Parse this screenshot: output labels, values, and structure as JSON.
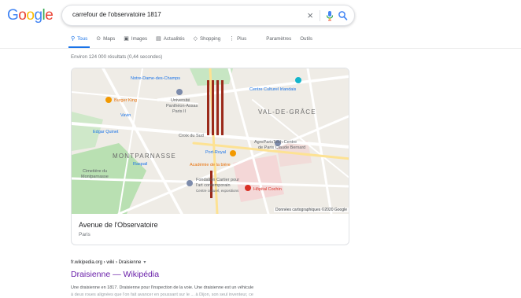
{
  "header": {
    "logo_letters": [
      "G",
      "o",
      "o",
      "g",
      "l",
      "e"
    ],
    "logo_colors": [
      "#4285f4",
      "#ea4335",
      "#fbbc05",
      "#4285f4",
      "#34a853",
      "#ea4335"
    ],
    "query": "carrefour de l'observatoire 1817",
    "clear_glyph": "×"
  },
  "tabs": [
    {
      "glyph": "⚲",
      "label": "Tous",
      "active": true
    },
    {
      "glyph": "⊙",
      "label": "Maps"
    },
    {
      "glyph": "▣",
      "label": "Images"
    },
    {
      "glyph": "▤",
      "label": "Actualités"
    },
    {
      "glyph": "◇",
      "label": "Shopping"
    },
    {
      "glyph": "⋮",
      "label": "Plus"
    }
  ],
  "tools": {
    "settings": "Paramètres",
    "tools": "Outils"
  },
  "result_stats": "Environ 124 000 résultats (0,44 secondes)",
  "map": {
    "labels": {
      "notre_dame": "Notre-Dame-des-Champs",
      "burger_king": "Burger King",
      "universite": "Université",
      "universite2": "Panthéon-Assas",
      "universite3": "Paris II",
      "vavin": "Vavin",
      "edgar_quinet": "Edgar Quinet",
      "centre_culturel": "Centre Culturel Irlandais",
      "val_de_grace": "VAL-DE-GRÂCE",
      "croix_sud": "Croix du Sud",
      "montparnasse": "MONTPARNASSE",
      "port_royal": "Port-Royal",
      "raspail": "Raspail",
      "agroparistech": "AgroParisTech-Centre",
      "agroparistech2": "de Paris Claude Bernard",
      "academie": "Académie de la bière",
      "cimetiere": "Cimetière du",
      "cimetiere2": "Montparnasse",
      "fondation": "Fondation Cartier pour",
      "fondation2": "l'art contemporain",
      "fondation3": "Centre culturel, expositions",
      "cochin": "Hôpital Cochin"
    },
    "copyright": "Données cartographiques ©2020 Google",
    "place_name": "Avenue de l'Observatoire",
    "place_city": "Paris"
  },
  "result": {
    "breadcrumb": "fr.wikipedia.org › wiki › Draisienne",
    "caret": "▾",
    "title": "Draisienne — Wikipédia",
    "snippet_line1": "Une draisienne en 1817. Draisienne pour l'inspection de la voie. Une draisienne est un véhicule",
    "snippet_line2": "à deux roues alignées que l'on fait avancer en poussant sur le ... à Dijon, son seul inventeur, ce"
  },
  "colors": {
    "accent": "#1a73e8",
    "visited_link": "#681da8",
    "route": "#a52714"
  }
}
